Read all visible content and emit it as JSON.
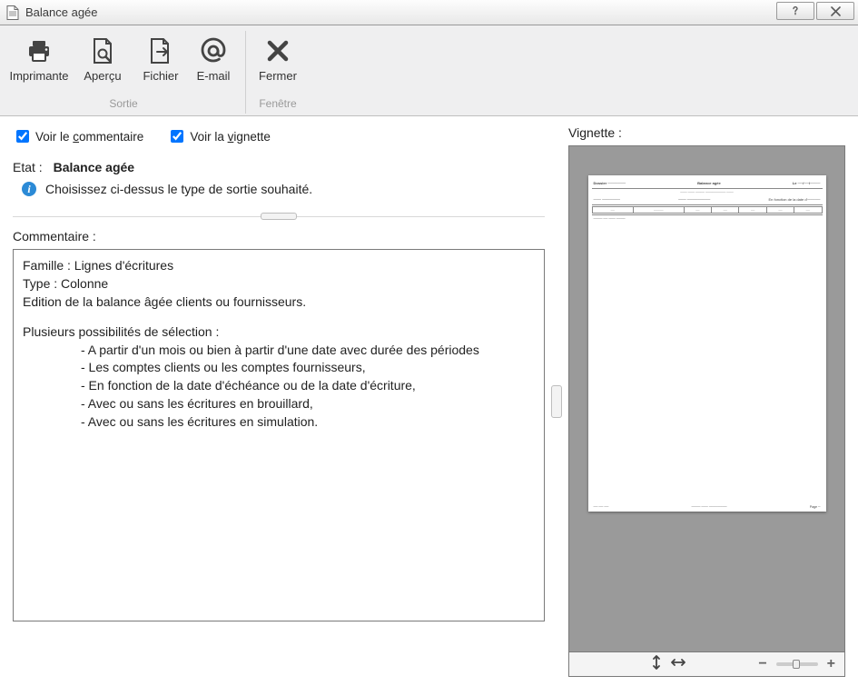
{
  "titlebar": {
    "title": "Balance agée"
  },
  "toolbar": {
    "group_sortie_caption": "Sortie",
    "group_fenetre_caption": "Fenêtre",
    "btn_print": "Imprimante",
    "btn_preview": "Aperçu",
    "btn_file": "Fichier",
    "btn_email": "E-mail",
    "btn_close": "Fermer"
  },
  "checks": {
    "voir_commentaire_pre": "Voir le ",
    "voir_commentaire_ul": "c",
    "voir_commentaire_post": "ommentaire",
    "voir_vignette_pre": "Voir la ",
    "voir_vignette_ul": "v",
    "voir_vignette_post": "ignette"
  },
  "etat": {
    "label": "Etat :",
    "value": "Balance agée"
  },
  "info": {
    "text": "Choisissez ci-dessus le type de sortie souhaité."
  },
  "commentaire": {
    "title": "Commentaire :",
    "lines": {
      "l0": "Famille : Lignes d'écritures",
      "l1": "Type : Colonne",
      "l2": "Edition de la balance âgée clients ou fournisseurs.",
      "l3": "Plusieurs possibilités de sélection :",
      "l4": "- A partir d'un mois ou bien à partir d'une date avec durée des périodes",
      "l5": "- Les comptes clients ou les comptes fournisseurs,",
      "l6": "- En fonction de la date d'échéance ou de la date d'écriture,",
      "l7": "- Avec ou sans les écritures en brouillard,",
      "l8": "- Avec ou sans les écritures en simulation."
    }
  },
  "vignette": {
    "title": "Vignette :"
  }
}
